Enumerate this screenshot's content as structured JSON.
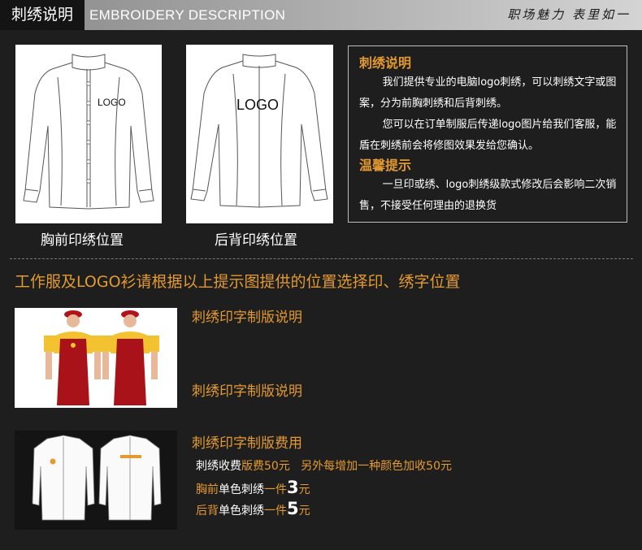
{
  "header": {
    "title_cn": "刺绣说明",
    "title_en": "EMBROIDERY DESCRIPTION",
    "slogan": "职场魅力 表里如一"
  },
  "shirts": {
    "front_logo": "LOGO",
    "back_logo": "LOGO",
    "front_caption": "胸前印绣位置",
    "back_caption": "后背印绣位置"
  },
  "description": {
    "heading": "刺绣说明",
    "para1": "我们提供专业的电脑logo刺绣，可以刺绣文字或图案，分为前胸刺绣和后背刺绣。",
    "para2": "您可以在订单制服后传递logo图片给我们客服，能盾在刺绣前会将修图效果发给您确认。",
    "tip_heading": "温馨提示",
    "tip_text": "一旦印或绣、logo刺绣级款式修改后会影响二次销售，不接受任何理由的退换货"
  },
  "instruction": "工作服及LOGO衫请根据以上提示图提供的位置选择印、绣字位置",
  "sections": {
    "title1": "刺绣印字制版说明",
    "title2": "刺绣印字制版说明",
    "title3": "刺绣印字制版费用"
  },
  "fees": {
    "line1_a": "刺绣收费",
    "line1_b": "版费50元",
    "line1_c": "另外每增加一种颜色加收50元",
    "line2_a": "胸前",
    "line2_b": "单色刺绣",
    "line2_c": "一件",
    "line2_num": "3",
    "line2_unit": "元",
    "line3_a": "后背",
    "line3_b": "单色刺绣",
    "line3_c": "一件",
    "line3_num": "5",
    "line3_unit": "元"
  },
  "colors": {
    "accent": "#e39a2f",
    "background": "#1f1e1e"
  }
}
